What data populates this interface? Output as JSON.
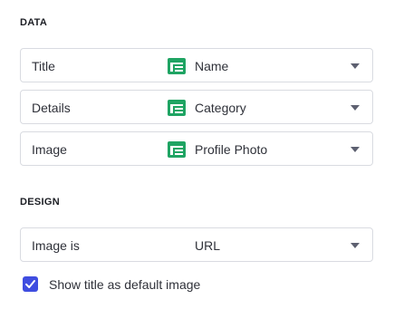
{
  "sections": {
    "data_title": "DATA",
    "design_title": "DESIGN"
  },
  "data_rows": [
    {
      "label": "Title",
      "value": "Name",
      "icon": "spreadsheet-column-icon"
    },
    {
      "label": "Details",
      "value": "Category",
      "icon": "spreadsheet-column-icon"
    },
    {
      "label": "Image",
      "value": "Profile Photo",
      "icon": "spreadsheet-column-icon"
    }
  ],
  "design_rows": [
    {
      "label": "Image is",
      "value": "URL"
    }
  ],
  "checkbox": {
    "label": "Show title as default image",
    "checked": true
  },
  "colors": {
    "accent": "#3f4de0",
    "icon_green": "#1fa463",
    "border": "#d9dbe1"
  }
}
